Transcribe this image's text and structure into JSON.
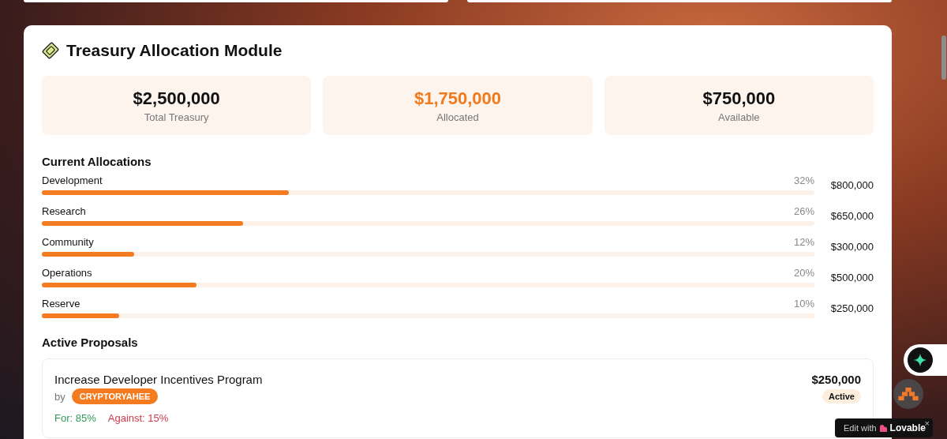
{
  "header": {
    "title": "Treasury Allocation Module"
  },
  "stats": [
    {
      "value": "$2,500,000",
      "label": "Total Treasury",
      "kind": "plain"
    },
    {
      "value": "$1,750,000",
      "label": "Allocated",
      "kind": "accent"
    },
    {
      "value": "$750,000",
      "label": "Available",
      "kind": "plain"
    }
  ],
  "allocations": {
    "heading": "Current Allocations",
    "items": [
      {
        "name": "Development",
        "percent": "32%",
        "amount": "$800,000",
        "level": 0.32
      },
      {
        "name": "Research",
        "percent": "26%",
        "amount": "$650,000",
        "level": 0.26
      },
      {
        "name": "Community",
        "percent": "12%",
        "amount": "$300,000",
        "level": 0.12
      },
      {
        "name": "Operations",
        "percent": "20%",
        "amount": "$500,000",
        "level": 0.2
      },
      {
        "name": "Reserve",
        "percent": "10%",
        "amount": "$250,000",
        "level": 0.1
      }
    ]
  },
  "proposals": {
    "heading": "Active Proposals",
    "items": [
      {
        "title": "Increase Developer Incentives Program",
        "by": "by",
        "author": "CRYPTORYAHEE",
        "for": "For: 85%",
        "against": "Against: 15%",
        "amount": "$250,000",
        "status": "Active"
      }
    ]
  },
  "edit_badge": {
    "prefix": "Edit with",
    "brand": "Lovable",
    "close": "×"
  }
}
